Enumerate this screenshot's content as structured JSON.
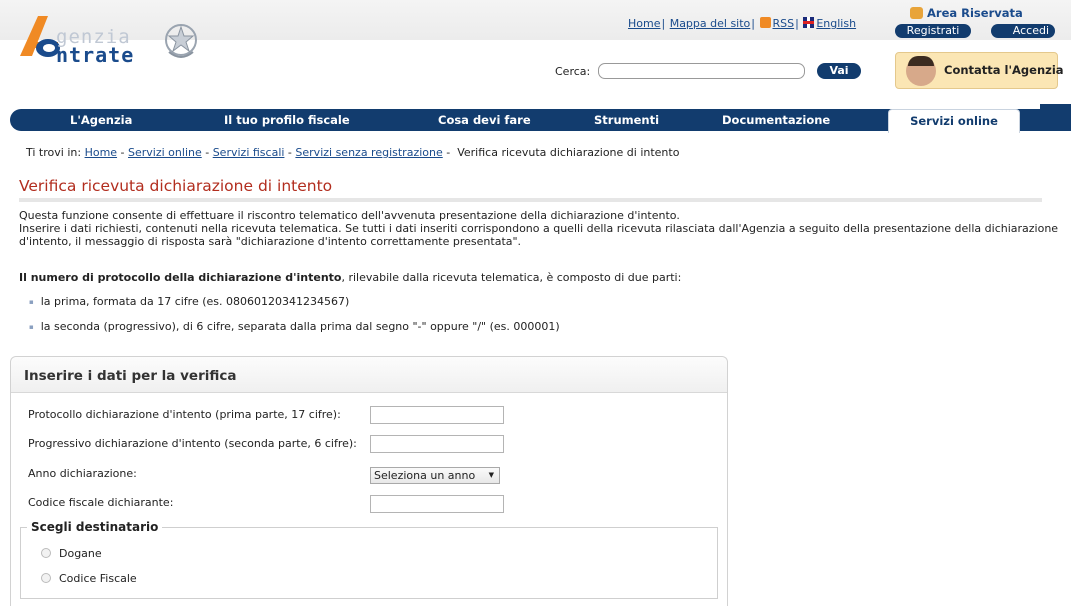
{
  "header": {
    "logo_line1": "genzia",
    "logo_line2": "ntrate",
    "links": {
      "home": "Home",
      "mappa": "Mappa del sito",
      "rss": "RSS",
      "english": "English"
    },
    "area_riservata": {
      "title": "Area Riservata",
      "registrati": "Registrati",
      "accedi": "Accedi"
    },
    "search": {
      "label": "Cerca:",
      "value": "",
      "button": "Vai"
    },
    "contatta": "Contatta l'Agenzia"
  },
  "nav": {
    "items": [
      "L'Agenzia",
      "Il tuo profilo fiscale",
      "Cosa devi fare",
      "Strumenti",
      "Documentazione",
      "Servizi online"
    ],
    "active": "Servizi online"
  },
  "breadcrumb": {
    "prefix": "Ti trovi in:",
    "links": [
      "Home",
      "Servizi online",
      "Servizi fiscali",
      "Servizi senza registrazione"
    ],
    "current": "Verifica ricevuta dichiarazione di intento"
  },
  "page": {
    "title": "Verifica ricevuta dichiarazione di intento",
    "intro1": "Questa funzione consente di effettuare il riscontro telematico dell'avvenuta presentazione della dichiarazione d'intento.",
    "intro2": "Inserire i dati richiesti, contenuti nella ricevuta telematica. Se tutti i dati inseriti corrispondono a quelli della ricevuta rilasciata dall'Agenzia a seguito della presentazione della dichiarazione",
    "intro3": "d'intento, il messaggio di risposta sarà \"dichiarazione d'intento correttamente presentata\".",
    "protocol_bold": "Il numero di protocollo della dichiarazione d'intento",
    "protocol_rest": ", rilevabile dalla ricevuta telematica, è composto di due parti:",
    "bullets": [
      "la prima, formata da 17 cifre (es. 08060120341234567)",
      "la seconda (progressivo), di 6 cifre, separata dalla prima dal segno \"-\" oppure \"/\" (es. 000001)"
    ]
  },
  "form": {
    "title": "Inserire i dati per la verifica",
    "protocollo_label": "Protocollo dichiarazione d'intento (prima parte, 17 cifre):",
    "protocollo_value": "",
    "progressivo_label": "Progressivo dichiarazione d'intento (seconda parte, 6 cifre):",
    "progressivo_value": "",
    "anno_label": "Anno dichiarazione:",
    "anno_selected": "Seleziona un anno",
    "codice_label": "Codice fiscale dichiarante:",
    "codice_value": "",
    "destinatario_legend": "Scegli destinatario",
    "radio_options": [
      "Dogane",
      "Codice Fiscale"
    ]
  },
  "colors": {
    "brand_blue": "#123c6e",
    "title_red": "#b22d1e",
    "link_blue": "#1a4b8c"
  }
}
